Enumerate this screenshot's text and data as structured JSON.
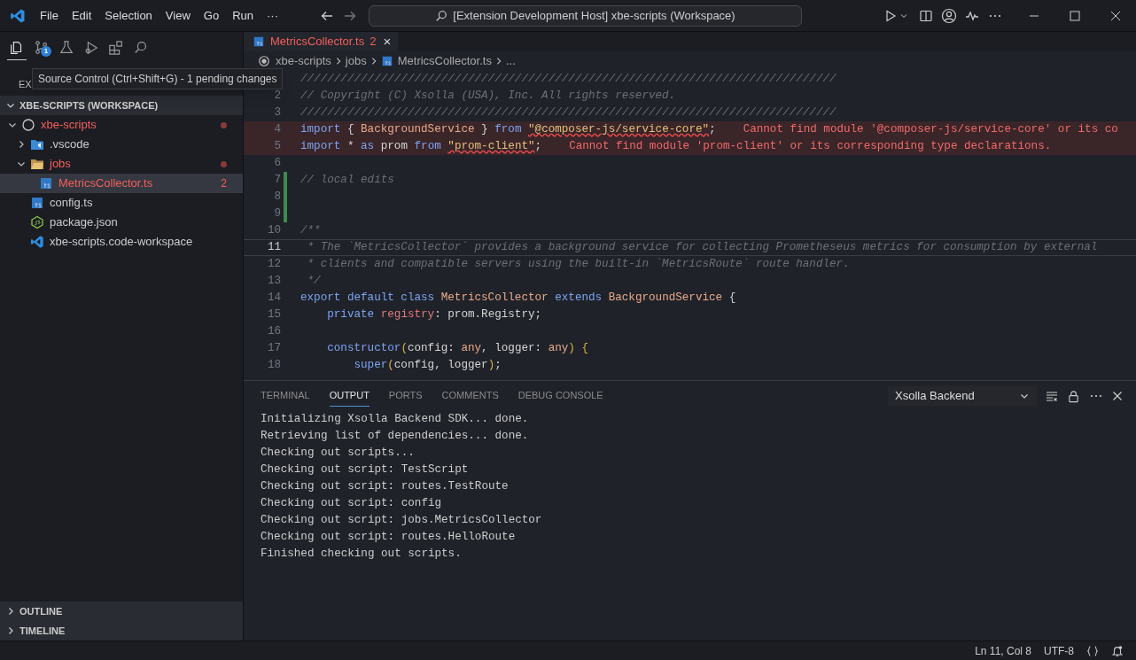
{
  "title_bar": {
    "menu": [
      "File",
      "Edit",
      "Selection",
      "View",
      "Go",
      "Run",
      "···"
    ],
    "command_center": "[Extension Development Host] xbe-scripts (Workspace)"
  },
  "activity_bar": {
    "items": [
      {
        "kind": "explorer",
        "selected": true
      },
      {
        "kind": "source-control",
        "selected": false,
        "badge": "1"
      },
      {
        "kind": "testing",
        "selected": false
      },
      {
        "kind": "run-debug",
        "selected": false
      },
      {
        "kind": "extensions",
        "selected": false
      },
      {
        "kind": "search",
        "selected": false
      }
    ],
    "tooltip": "Source Control (Ctrl+Shift+G) - 1 pending changes",
    "covered_header": "EX"
  },
  "explorer": {
    "section": "XBE-SCRIPTS (WORKSPACE)",
    "tree": [
      {
        "label": "xbe-scripts",
        "kind": "root",
        "expanded": true,
        "modified": true,
        "selected": false,
        "children": [
          {
            "label": ".vscode",
            "kind": "vscode-folder",
            "expanded": false,
            "modified": false,
            "selected": false
          },
          {
            "label": "jobs",
            "kind": "folder",
            "expanded": true,
            "modified": true,
            "selected": false,
            "children": [
              {
                "label": "MetricsCollector.ts",
                "kind": "ts",
                "modified": true,
                "selected": true,
                "problems": "2"
              }
            ]
          },
          {
            "label": "config.ts",
            "kind": "ts",
            "modified": false,
            "selected": false
          },
          {
            "label": "package.json",
            "kind": "node",
            "modified": false,
            "selected": false
          },
          {
            "label": "xbe-scripts.code-workspace",
            "kind": "workspace",
            "modified": false,
            "selected": false
          }
        ]
      }
    ],
    "collapsed_sections": [
      "OUTLINE",
      "TIMELINE"
    ]
  },
  "editor": {
    "tab": {
      "label": "MetricsCollector.ts",
      "problems": "2",
      "close": "×"
    },
    "breadcrumbs": [
      "xbe-scripts",
      "jobs",
      "MetricsCollector.ts",
      "..."
    ],
    "lines": [
      {
        "modified": false,
        "current": false,
        "segments": [
          {
            "kind": "comment",
            "text": "////////////////////////////////////////////////////////////////////////////////"
          }
        ]
      },
      {
        "n": "2",
        "modified": false,
        "current": false,
        "segments": [
          {
            "kind": "comment",
            "text": "// Copyright (C) Xsolla (USA), Inc. All rights reserved."
          }
        ]
      },
      {
        "n": "3",
        "modified": false,
        "current": false,
        "segments": [
          {
            "kind": "comment",
            "text": "////////////////////////////////////////////////////////////////////////////////"
          }
        ]
      },
      {
        "n": "4",
        "modified": false,
        "current": false,
        "diagnostic": "Cannot find module '@composer-js/service-core' or its co",
        "segments": [
          {
            "kind": "keyword",
            "text": "import"
          },
          {
            "kind": "plain",
            "text": " { "
          },
          {
            "kind": "type",
            "text": "BackgroundService"
          },
          {
            "kind": "plain",
            "text": " } "
          },
          {
            "kind": "keyword",
            "text": "from "
          },
          {
            "kind": "error-string",
            "text": "\"@composer-js/service-core\""
          },
          {
            "kind": "plain",
            "text": ";"
          }
        ]
      },
      {
        "n": "5",
        "modified": false,
        "current": false,
        "diagnostic": "Cannot find module 'prom-client' or its corresponding type declarations.",
        "segments": [
          {
            "kind": "keyword",
            "text": "import"
          },
          {
            "kind": "plain",
            "text": " * "
          },
          {
            "kind": "keyword",
            "text": "as"
          },
          {
            "kind": "plain",
            "text": " prom "
          },
          {
            "kind": "keyword",
            "text": "from "
          },
          {
            "kind": "error-string",
            "text": "\"prom-client\""
          },
          {
            "kind": "plain",
            "text": ";"
          }
        ]
      },
      {
        "n": "6",
        "modified": false,
        "current": false
      },
      {
        "n": "7",
        "modified": true,
        "current": false,
        "segments": [
          {
            "kind": "comment",
            "text": "// local edits"
          }
        ]
      },
      {
        "n": "8",
        "modified": true,
        "current": false
      },
      {
        "n": "9",
        "modified": true,
        "current": false
      },
      {
        "n": "10",
        "modified": false,
        "current": false,
        "segments": [
          {
            "kind": "comment",
            "text": "/**"
          }
        ]
      },
      {
        "n": "11",
        "modified": false,
        "current": true,
        "segments": [
          {
            "kind": "comment",
            "text": " * The `MetricsCollector` provides a background service for collecting Prometheseus metrics for consumption by external"
          }
        ]
      },
      {
        "n": "12",
        "modified": false,
        "current": false,
        "segments": [
          {
            "kind": "comment",
            "text": " * clients and compatible servers using the built-in `MetricsRoute` route handler."
          }
        ]
      },
      {
        "n": "13",
        "modified": false,
        "current": false,
        "segments": [
          {
            "kind": "comment",
            "text": " */"
          }
        ]
      },
      {
        "n": "14",
        "modified": false,
        "current": false,
        "segments": [
          {
            "kind": "keyword",
            "text": "export default class "
          },
          {
            "kind": "type",
            "text": "MetricsCollector "
          },
          {
            "kind": "keyword",
            "text": "extends "
          },
          {
            "kind": "type",
            "text": "BackgroundService"
          },
          {
            "kind": "plain",
            "text": " {"
          }
        ]
      },
      {
        "n": "15",
        "modified": false,
        "current": false,
        "segments": [
          {
            "kind": "keyword",
            "text": "    private "
          },
          {
            "kind": "property",
            "text": "registry"
          },
          {
            "kind": "plain",
            "text": ": prom.Registry;"
          }
        ]
      },
      {
        "n": "16",
        "modified": false,
        "current": false
      },
      {
        "n": "17",
        "modified": false,
        "current": false,
        "segments": [
          {
            "kind": "keyword",
            "text": "    constructor"
          },
          {
            "kind": "bracket",
            "text": "("
          },
          {
            "kind": "plain",
            "text": "config: "
          },
          {
            "kind": "type",
            "text": "any"
          },
          {
            "kind": "plain",
            "text": ", logger: "
          },
          {
            "kind": "type",
            "text": "any"
          },
          {
            "kind": "bracket",
            "text": ")"
          },
          {
            "kind": "bracket",
            "text": " {"
          }
        ]
      },
      {
        "n": "18",
        "modified": false,
        "current": false,
        "segments": [
          {
            "kind": "keyword",
            "text": "        super"
          },
          {
            "kind": "bracket",
            "text": "("
          },
          {
            "kind": "plain",
            "text": "config, logger"
          },
          {
            "kind": "bracket",
            "text": ")"
          },
          {
            "kind": "plain",
            "text": ";"
          }
        ]
      }
    ]
  },
  "panel": {
    "tabs": [
      {
        "label": "TERMINAL",
        "selected": false
      },
      {
        "label": "OUTPUT",
        "selected": true
      },
      {
        "label": "PORTS",
        "selected": false
      },
      {
        "label": "COMMENTS",
        "selected": false
      },
      {
        "label": "DEBUG CONSOLE",
        "selected": false
      }
    ],
    "channel": "Xsolla Backend",
    "output": [
      "Initializing Xsolla Backend SDK... done.",
      "Retrieving list of dependencies... done.",
      "Checking out scripts...",
      "Checking out script: TestScript",
      "Checking out script: routes.TestRoute",
      "Checking out script: config",
      "Checking out script: jobs.MetricsCollector",
      "Checking out script: routes.HelloRoute",
      "Finished checking out scripts."
    ]
  },
  "status_bar": {
    "items": [
      "Ln 11, Col 8",
      "UTF-8"
    ]
  }
}
